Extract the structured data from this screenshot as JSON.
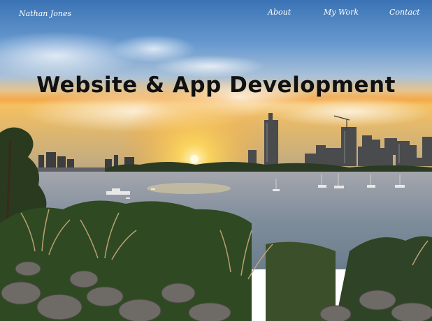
{
  "nav": {
    "brand": "Nathan Jones",
    "links": [
      {
        "label": "About"
      },
      {
        "label": "My Work"
      },
      {
        "label": "Contact"
      }
    ]
  },
  "hero": {
    "headline": "Website & App Development",
    "background": "sunset city river skyline photo"
  },
  "colors": {
    "sky_top": "#3f78b8",
    "sun": "#ffd75a",
    "water": "#8d9aa8",
    "foliage": "#2f4a22"
  }
}
